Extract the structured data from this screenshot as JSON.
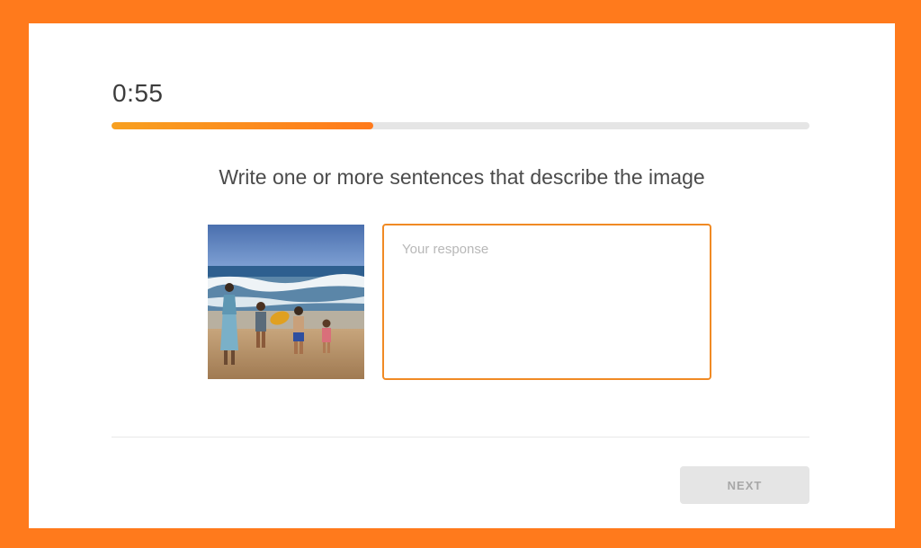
{
  "timer": {
    "text": "0:55"
  },
  "progress": {
    "fraction": 0.375,
    "fill_color": "#ff7a1c"
  },
  "prompt": {
    "text": "Write one or more sentences that describe the image"
  },
  "response": {
    "placeholder": "Your response",
    "value": ""
  },
  "footer": {
    "next_label": "NEXT"
  },
  "colors": {
    "frame": "#ff7a1c",
    "accent": "#f08a24",
    "disabled_button": "#e5e5e5"
  }
}
